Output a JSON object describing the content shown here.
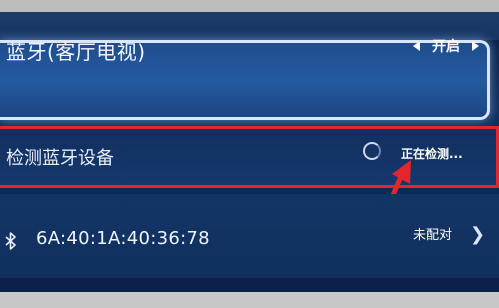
{
  "bluetooth_row": {
    "label": "蓝牙(客厅电视)",
    "value": "开启"
  },
  "detect_row": {
    "label": "检测蓝牙设备",
    "status": "正在检测..."
  },
  "device_row": {
    "mac": "6A:40:1A:40:36:78",
    "status": "未配对"
  },
  "colors": {
    "highlight_border": "#e3262c",
    "focus_border": "#d9e6ff",
    "background": "#12305e"
  },
  "icons": {
    "left": "triangle-left-icon",
    "right": "triangle-right-icon",
    "loading": "loading-spinner-icon",
    "bluetooth": "bluetooth-icon",
    "chevron": "chevron-right-icon",
    "annotation": "red-arrow-annotation"
  }
}
